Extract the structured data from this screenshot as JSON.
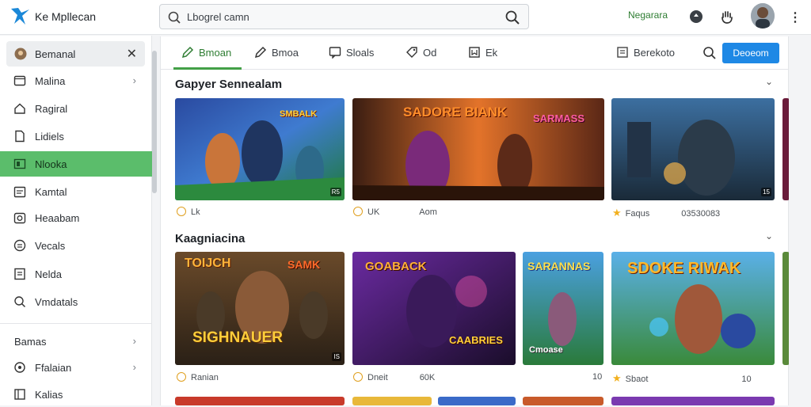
{
  "app": {
    "title": "Ke Mpllecan"
  },
  "search": {
    "placeholder": "Lbogrel camn"
  },
  "topbar": {
    "link_label": "Negarara"
  },
  "sidebar": {
    "header": {
      "label": "Bemanal"
    },
    "items": [
      {
        "label": "Malina"
      },
      {
        "label": "Ragiral"
      },
      {
        "label": "Lidiels"
      },
      {
        "label": "Nlooka"
      },
      {
        "label": "Kamtal"
      },
      {
        "label": "Heaabam"
      },
      {
        "label": "Vecals"
      },
      {
        "label": "Nelda"
      },
      {
        "label": "Vmdatals"
      }
    ],
    "lower_items": [
      {
        "label": "Bamas"
      },
      {
        "label": "Ffalaian"
      },
      {
        "label": "Kalias"
      }
    ]
  },
  "tabs": [
    {
      "label": "Bmoan"
    },
    {
      "label": "Bmoa"
    },
    {
      "label": "Sloals"
    },
    {
      "label": "Od"
    },
    {
      "label": "Ek"
    }
  ],
  "toolbar": {
    "filter_label": "Berekoto",
    "primary_label": "Deoeom"
  },
  "sections": [
    {
      "title": "Gapyer Sennealam",
      "cards": [
        {
          "overlay": "SMBALK",
          "meta": "Lk",
          "badge": "R5"
        },
        {
          "overlay": "SADORE BIANK",
          "overlay2": "SARMASS",
          "meta": "UK",
          "meta_num": "Aom",
          "badge": ""
        },
        {
          "overlay": "",
          "meta": "Faqus",
          "meta_num": "03530083",
          "badge": "15"
        }
      ]
    },
    {
      "title": "Kaagniacina",
      "cards": [
        {
          "overlay": "TOIJCH",
          "overlay2": "SAMK",
          "overlay3": "SIGHNAUER",
          "meta": "Ranian",
          "badge": "IS"
        },
        {
          "overlay": "GOABACK",
          "overlay2": "CAABRIES",
          "meta": "Dneit",
          "meta_num": "60K",
          "badge": ""
        },
        {
          "overlay": "SARANNAS",
          "overlay2": "Cmoase",
          "meta": "",
          "meta_num": "10",
          "badge": ""
        },
        {
          "overlay": "SDOKE RIWAK",
          "meta": "Sbaot",
          "meta_num": "10",
          "badge": ""
        }
      ]
    }
  ],
  "colors": {
    "accent": "#43a047",
    "primary": "#1e88e5",
    "active_bg": "#5bbd6b"
  }
}
